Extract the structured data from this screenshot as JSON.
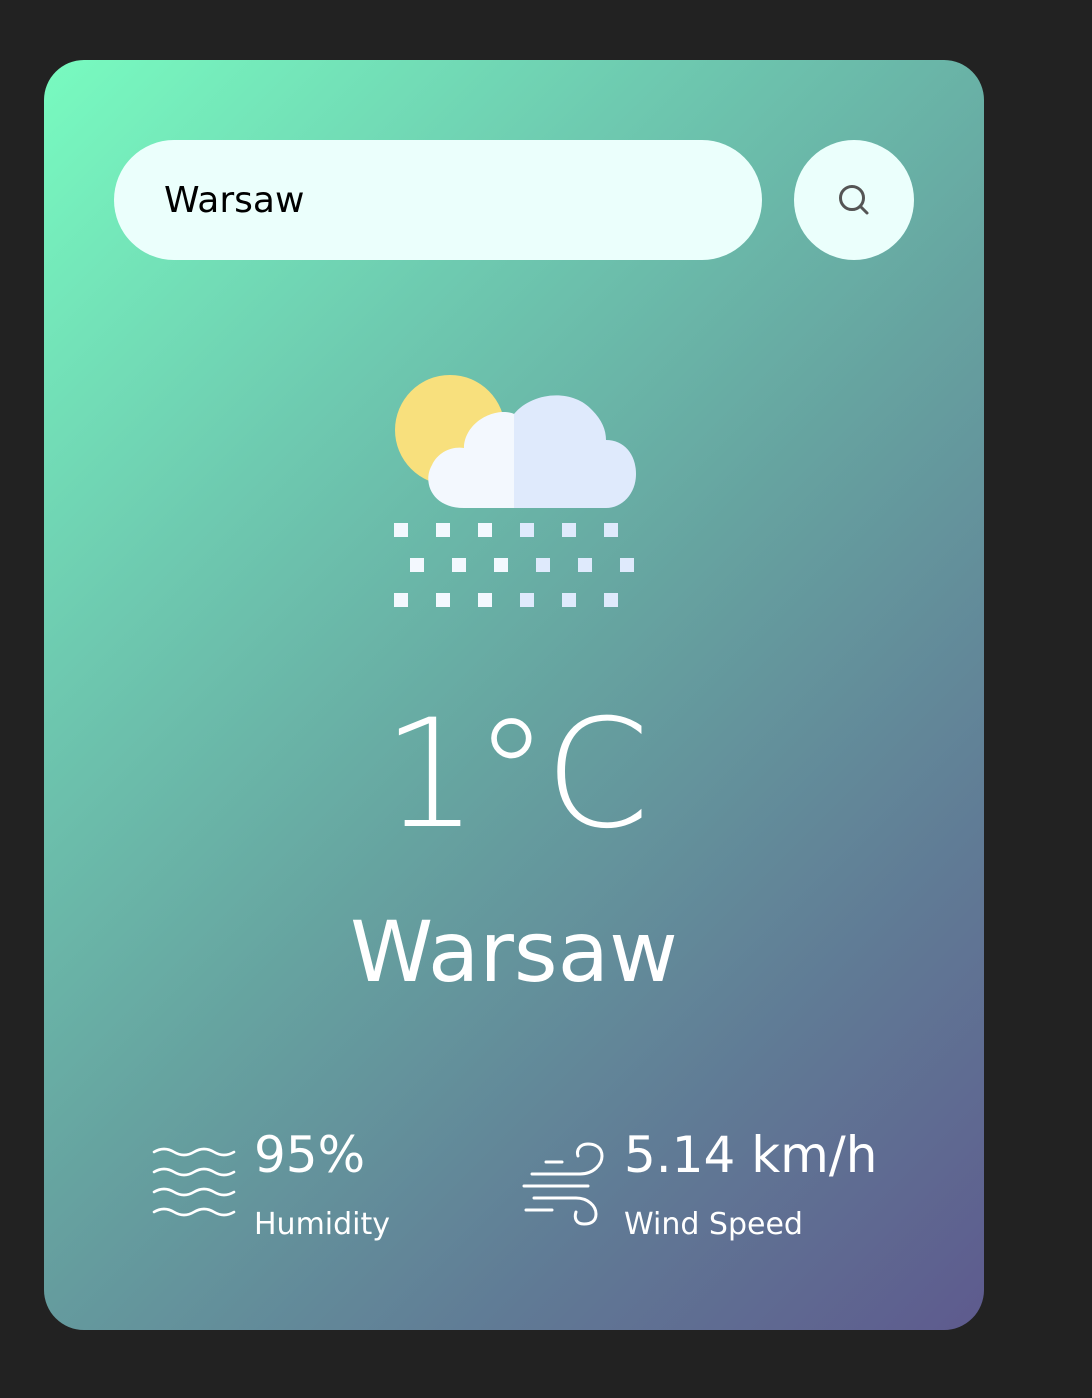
{
  "search": {
    "value": "Warsaw",
    "button_icon": "search-icon"
  },
  "weather": {
    "icon": "sun-cloud-snow-icon",
    "temperature": "1°C",
    "city": "Warsaw"
  },
  "details": {
    "humidity": {
      "icon": "humidity-waves-icon",
      "value": "95%",
      "label": "Humidity"
    },
    "wind": {
      "icon": "wind-icon",
      "value": "5.14 km/h",
      "label": "Wind Speed"
    }
  },
  "colors": {
    "page_background": "#222222",
    "card_gradient_start": "#78fbc0",
    "card_gradient_end": "#5e5a8e",
    "input_background": "#ebfffc",
    "text": "#ffffff"
  }
}
